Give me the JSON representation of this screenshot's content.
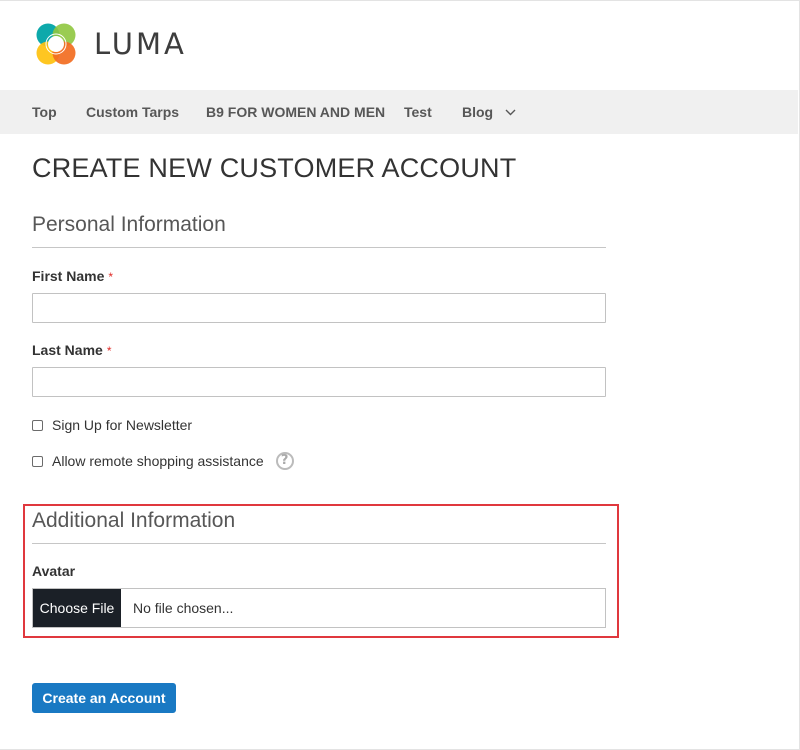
{
  "brand": {
    "logo_text": "LUMA",
    "logo_icon": "luma-logo-icon",
    "logo_colors": [
      "#00a4a6",
      "#f26d21",
      "#fec10e",
      "#fe8119"
    ]
  },
  "nav": {
    "items": [
      {
        "label": "Top"
      },
      {
        "label": "Custom Tarps"
      },
      {
        "label": "B9 FOR WOMEN AND MEN"
      },
      {
        "label": "Test"
      },
      {
        "label": "Blog",
        "icon": "chevron-down-icon"
      }
    ]
  },
  "page": {
    "title": "CREATE NEW CUSTOMER ACCOUNT"
  },
  "personal": {
    "legend": "Personal Information",
    "first_name": {
      "label": "First Name",
      "required_mark": "*",
      "value": ""
    },
    "last_name": {
      "label": "Last Name",
      "required_mark": "*",
      "value": ""
    },
    "newsletter": {
      "label": "Sign Up for Newsletter",
      "checked": false
    },
    "remote_assistance": {
      "label": "Allow remote shopping assistance",
      "checked": false,
      "help_icon": "question-circle-icon",
      "help_glyph": "?"
    }
  },
  "additional": {
    "legend": "Additional Information",
    "avatar": {
      "label": "Avatar",
      "button_label": "Choose File",
      "status": "No file chosen..."
    }
  },
  "actions": {
    "submit_label": "Create an Account"
  },
  "colors": {
    "primary": "#1979c3",
    "required": "#e02b27",
    "highlight": "#e0383e",
    "nav_bg": "#f0f0f0",
    "file_button_bg": "#1b2027"
  }
}
